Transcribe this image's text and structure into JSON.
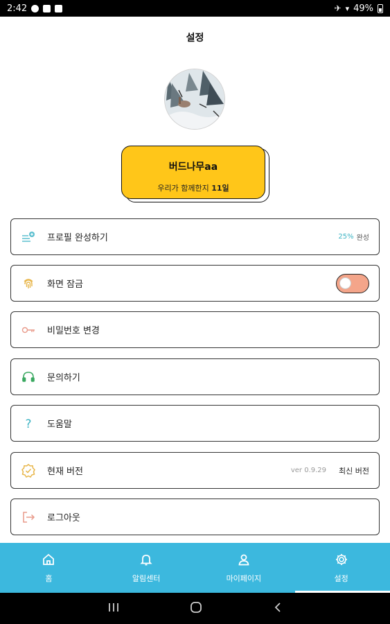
{
  "status_bar": {
    "time": "2:42",
    "battery": "49%"
  },
  "header": {
    "title": "설정"
  },
  "profile": {
    "name": "버드나무aa",
    "days_prefix": "우리가 함께한지",
    "days_value": "11일"
  },
  "menu": {
    "profile_complete": {
      "label": "프로필 완성하기",
      "percent": "25%",
      "suffix": "완성"
    },
    "screen_lock": {
      "label": "화면 잠금",
      "enabled": false
    },
    "change_password": {
      "label": "비밀번호 변경"
    },
    "inquiry": {
      "label": "문의하기"
    },
    "help": {
      "label": "도움말"
    },
    "version": {
      "label": "현재 버전",
      "value": "ver 0.9.29",
      "status": "최신 버전"
    },
    "logout": {
      "label": "로그아웃"
    }
  },
  "bottom_nav": {
    "home": "홈",
    "alerts": "알림센터",
    "mypage": "마이페이지",
    "settings": "설정"
  },
  "colors": {
    "accent_yellow": "#ffc619",
    "accent_teal": "#3bb3c3",
    "nav_blue": "#3cb8de",
    "toggle_salmon": "#f4a58a"
  }
}
